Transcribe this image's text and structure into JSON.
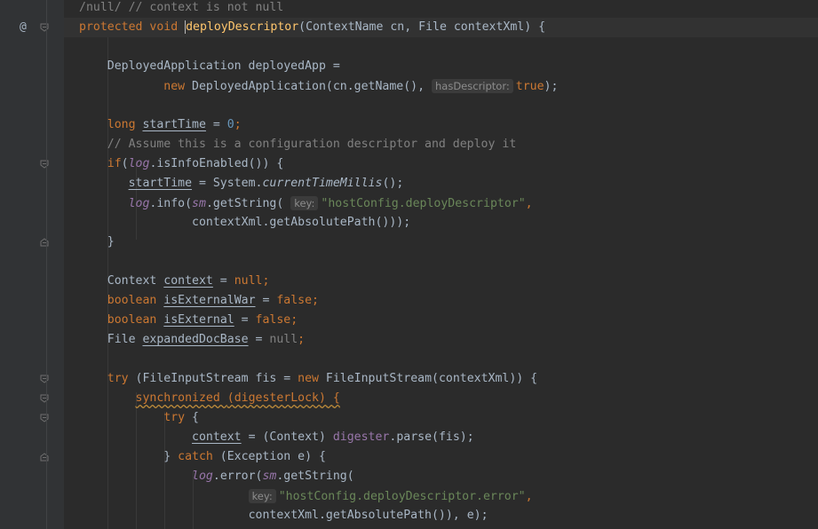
{
  "gutter": {
    "annotation_symbol": "@"
  },
  "lines": [
    {
      "t": [
        [
          "cm",
          "/null/ // context is not null"
        ]
      ]
    },
    {
      "t": [
        [
          "kw",
          "protected "
        ],
        [
          "kw",
          "void "
        ],
        [
          "fn",
          "deployDescriptor"
        ],
        [
          "",
          "(ContextName cn, File contextXml) {"
        ]
      ]
    },
    {
      "t": []
    },
    {
      "t": [
        [
          "",
          "    DeployedApplication deployedApp ="
        ]
      ]
    },
    {
      "t": [
        [
          "",
          "            "
        ],
        [
          "kw",
          "new "
        ],
        [
          "",
          "DeployedApplication(cn.getName(), "
        ],
        [
          "hint",
          "hasDescriptor:"
        ],
        [
          "kw",
          "true"
        ],
        [
          "",
          ");"
        ]
      ]
    },
    {
      "t": []
    },
    {
      "t": [
        [
          "",
          "    "
        ],
        [
          "kw",
          "long "
        ],
        [
          "ul",
          "startTime"
        ],
        [
          "",
          " = "
        ],
        [
          "num",
          "0"
        ],
        [
          "kw",
          ";"
        ]
      ]
    },
    {
      "t": [
        [
          "",
          "    "
        ],
        [
          "cm",
          "// Assume this is a configuration descriptor and deploy it"
        ]
      ]
    },
    {
      "t": [
        [
          "",
          "    "
        ],
        [
          "kw",
          "if"
        ],
        [
          "",
          "("
        ],
        [
          "st",
          "log"
        ],
        [
          "",
          ".isInfoEnabled()) {"
        ]
      ]
    },
    {
      "t": [
        [
          "",
          "       "
        ],
        [
          "ul",
          "startTime"
        ],
        [
          "",
          " = System."
        ],
        [
          "ital",
          "currentTimeMillis"
        ],
        [
          "",
          "();"
        ]
      ]
    },
    {
      "t": [
        [
          "",
          "       "
        ],
        [
          "st",
          "log"
        ],
        [
          "",
          ".info("
        ],
        [
          "st",
          "sm"
        ],
        [
          "",
          ".getString( "
        ],
        [
          "hint",
          "key:"
        ],
        [
          "str",
          "\"hostConfig.deployDescriptor\""
        ],
        [
          "kw",
          ","
        ]
      ]
    },
    {
      "t": [
        [
          "",
          "                "
        ],
        [
          "",
          "contextXml.getAbsolutePath()));"
        ]
      ]
    },
    {
      "t": [
        [
          "",
          "    }"
        ]
      ]
    },
    {
      "t": []
    },
    {
      "t": [
        [
          "",
          "    Context "
        ],
        [
          "ul",
          "context"
        ],
        [
          "",
          " = "
        ],
        [
          "kw",
          "null;"
        ]
      ]
    },
    {
      "t": [
        [
          "",
          "    "
        ],
        [
          "kw",
          "boolean "
        ],
        [
          "ul",
          "isExternalWar"
        ],
        [
          "",
          " = "
        ],
        [
          "kw",
          "false;"
        ]
      ]
    },
    {
      "t": [
        [
          "",
          "    "
        ],
        [
          "kw",
          "boolean "
        ],
        [
          "ul",
          "isExternal"
        ],
        [
          "",
          " = "
        ],
        [
          "kw",
          "false;"
        ]
      ]
    },
    {
      "t": [
        [
          "",
          "    File "
        ],
        [
          "ul",
          "expandedDocBase"
        ],
        [
          "",
          " = "
        ],
        [
          "dim",
          "null"
        ],
        [
          "kw",
          ";"
        ]
      ]
    },
    {
      "t": []
    },
    {
      "t": [
        [
          "",
          "    "
        ],
        [
          "kw",
          "try "
        ],
        [
          "",
          "(FileInputStream fis = "
        ],
        [
          "kw",
          "new "
        ],
        [
          "",
          "FileInputStream(contextXml)) {"
        ]
      ]
    },
    {
      "t": [
        [
          "",
          "        "
        ],
        [
          "kwul",
          "synchronized "
        ],
        [
          "kwul",
          "(digesterLock) {"
        ]
      ]
    },
    {
      "t": [
        [
          "",
          "            "
        ],
        [
          "kw",
          "try "
        ],
        [
          "",
          "{"
        ]
      ]
    },
    {
      "t": [
        [
          "",
          "                "
        ],
        [
          "ul",
          "context"
        ],
        [
          "",
          " = (Context) "
        ],
        [
          "fld",
          "digester"
        ],
        [
          "",
          ".parse(fis);"
        ]
      ]
    },
    {
      "t": [
        [
          "",
          "            } "
        ],
        [
          "kw",
          "catch "
        ],
        [
          "",
          "(Exception e) {"
        ]
      ]
    },
    {
      "t": [
        [
          "",
          "                "
        ],
        [
          "st",
          "log"
        ],
        [
          "",
          ".error("
        ],
        [
          "st",
          "sm"
        ],
        [
          "",
          ".getString("
        ]
      ]
    },
    {
      "t": [
        [
          "",
          "                        "
        ],
        [
          "hint",
          "key:"
        ],
        [
          "str",
          "\"hostConfig.deployDescriptor.error\""
        ],
        [
          "kw",
          ","
        ]
      ]
    },
    {
      "t": [
        [
          "",
          "                        "
        ],
        [
          "",
          "contextXml.getAbsolutePath()), e);"
        ]
      ]
    }
  ]
}
